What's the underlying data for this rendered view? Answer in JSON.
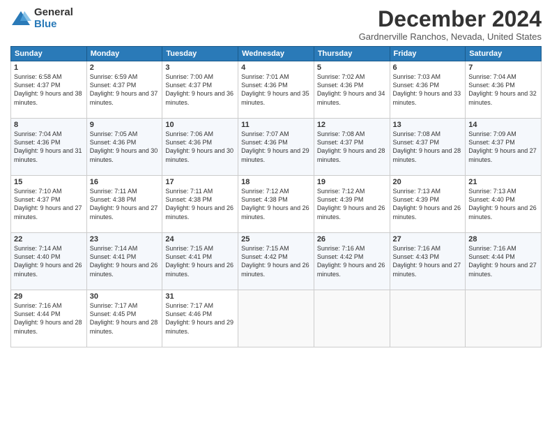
{
  "logo": {
    "general": "General",
    "blue": "Blue"
  },
  "title": "December 2024",
  "location": "Gardnerville Ranchos, Nevada, United States",
  "days_header": [
    "Sunday",
    "Monday",
    "Tuesday",
    "Wednesday",
    "Thursday",
    "Friday",
    "Saturday"
  ],
  "weeks": [
    [
      {
        "day": "1",
        "sunrise": "6:58 AM",
        "sunset": "4:37 PM",
        "daylight": "9 hours and 38 minutes."
      },
      {
        "day": "2",
        "sunrise": "6:59 AM",
        "sunset": "4:37 PM",
        "daylight": "9 hours and 37 minutes."
      },
      {
        "day": "3",
        "sunrise": "7:00 AM",
        "sunset": "4:37 PM",
        "daylight": "9 hours and 36 minutes."
      },
      {
        "day": "4",
        "sunrise": "7:01 AM",
        "sunset": "4:36 PM",
        "daylight": "9 hours and 35 minutes."
      },
      {
        "day": "5",
        "sunrise": "7:02 AM",
        "sunset": "4:36 PM",
        "daylight": "9 hours and 34 minutes."
      },
      {
        "day": "6",
        "sunrise": "7:03 AM",
        "sunset": "4:36 PM",
        "daylight": "9 hours and 33 minutes."
      },
      {
        "day": "7",
        "sunrise": "7:04 AM",
        "sunset": "4:36 PM",
        "daylight": "9 hours and 32 minutes."
      }
    ],
    [
      {
        "day": "8",
        "sunrise": "7:04 AM",
        "sunset": "4:36 PM",
        "daylight": "9 hours and 31 minutes."
      },
      {
        "day": "9",
        "sunrise": "7:05 AM",
        "sunset": "4:36 PM",
        "daylight": "9 hours and 30 minutes."
      },
      {
        "day": "10",
        "sunrise": "7:06 AM",
        "sunset": "4:36 PM",
        "daylight": "9 hours and 30 minutes."
      },
      {
        "day": "11",
        "sunrise": "7:07 AM",
        "sunset": "4:36 PM",
        "daylight": "9 hours and 29 minutes."
      },
      {
        "day": "12",
        "sunrise": "7:08 AM",
        "sunset": "4:37 PM",
        "daylight": "9 hours and 28 minutes."
      },
      {
        "day": "13",
        "sunrise": "7:08 AM",
        "sunset": "4:37 PM",
        "daylight": "9 hours and 28 minutes."
      },
      {
        "day": "14",
        "sunrise": "7:09 AM",
        "sunset": "4:37 PM",
        "daylight": "9 hours and 27 minutes."
      }
    ],
    [
      {
        "day": "15",
        "sunrise": "7:10 AM",
        "sunset": "4:37 PM",
        "daylight": "9 hours and 27 minutes."
      },
      {
        "day": "16",
        "sunrise": "7:11 AM",
        "sunset": "4:38 PM",
        "daylight": "9 hours and 27 minutes."
      },
      {
        "day": "17",
        "sunrise": "7:11 AM",
        "sunset": "4:38 PM",
        "daylight": "9 hours and 26 minutes."
      },
      {
        "day": "18",
        "sunrise": "7:12 AM",
        "sunset": "4:38 PM",
        "daylight": "9 hours and 26 minutes."
      },
      {
        "day": "19",
        "sunrise": "7:12 AM",
        "sunset": "4:39 PM",
        "daylight": "9 hours and 26 minutes."
      },
      {
        "day": "20",
        "sunrise": "7:13 AM",
        "sunset": "4:39 PM",
        "daylight": "9 hours and 26 minutes."
      },
      {
        "day": "21",
        "sunrise": "7:13 AM",
        "sunset": "4:40 PM",
        "daylight": "9 hours and 26 minutes."
      }
    ],
    [
      {
        "day": "22",
        "sunrise": "7:14 AM",
        "sunset": "4:40 PM",
        "daylight": "9 hours and 26 minutes."
      },
      {
        "day": "23",
        "sunrise": "7:14 AM",
        "sunset": "4:41 PM",
        "daylight": "9 hours and 26 minutes."
      },
      {
        "day": "24",
        "sunrise": "7:15 AM",
        "sunset": "4:41 PM",
        "daylight": "9 hours and 26 minutes."
      },
      {
        "day": "25",
        "sunrise": "7:15 AM",
        "sunset": "4:42 PM",
        "daylight": "9 hours and 26 minutes."
      },
      {
        "day": "26",
        "sunrise": "7:16 AM",
        "sunset": "4:42 PM",
        "daylight": "9 hours and 26 minutes."
      },
      {
        "day": "27",
        "sunrise": "7:16 AM",
        "sunset": "4:43 PM",
        "daylight": "9 hours and 27 minutes."
      },
      {
        "day": "28",
        "sunrise": "7:16 AM",
        "sunset": "4:44 PM",
        "daylight": "9 hours and 27 minutes."
      }
    ],
    [
      {
        "day": "29",
        "sunrise": "7:16 AM",
        "sunset": "4:44 PM",
        "daylight": "9 hours and 28 minutes."
      },
      {
        "day": "30",
        "sunrise": "7:17 AM",
        "sunset": "4:45 PM",
        "daylight": "9 hours and 28 minutes."
      },
      {
        "day": "31",
        "sunrise": "7:17 AM",
        "sunset": "4:46 PM",
        "daylight": "9 hours and 29 minutes."
      },
      null,
      null,
      null,
      null
    ]
  ],
  "labels": {
    "sunrise": "Sunrise:",
    "sunset": "Sunset:",
    "daylight": "Daylight:"
  }
}
